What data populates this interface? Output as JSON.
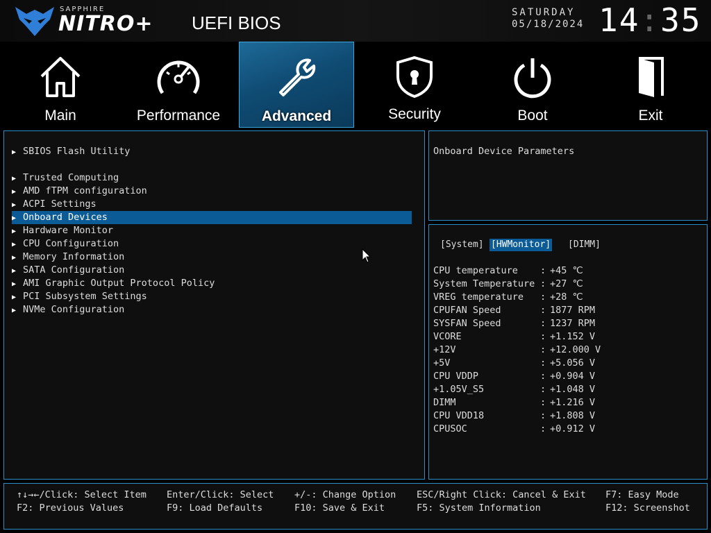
{
  "header": {
    "brand_small": "SAPPHIRE",
    "brand_big": "NITRO+",
    "title": "UEFI BIOS",
    "day": "SATURDAY",
    "date": "05/18/2024",
    "time_hours": "14",
    "time_minutes": "35"
  },
  "tabs": [
    {
      "label": "Main",
      "icon": "home-icon"
    },
    {
      "label": "Performance",
      "icon": "speedometer-icon"
    },
    {
      "label": "Advanced",
      "icon": "wrench-icon",
      "active": true
    },
    {
      "label": "Security",
      "icon": "shield-lock-icon"
    },
    {
      "label": "Boot",
      "icon": "power-icon"
    },
    {
      "label": "Exit",
      "icon": "door-exit-icon"
    }
  ],
  "menu": {
    "items": [
      {
        "label": "SBIOS Flash Utility"
      },
      {
        "label": "Trusted Computing"
      },
      {
        "label": "AMD fTPM configuration"
      },
      {
        "label": "ACPI Settings"
      },
      {
        "label": "Onboard Devices",
        "selected": true
      },
      {
        "label": "Hardware Monitor"
      },
      {
        "label": "CPU Configuration"
      },
      {
        "label": "Memory Information"
      },
      {
        "label": "SATA Configuration"
      },
      {
        "label": "AMI Graphic Output Protocol Policy"
      },
      {
        "label": "PCI Subsystem Settings"
      },
      {
        "label": "NVMe Configuration"
      }
    ]
  },
  "help": {
    "text": "Onboard Device Parameters"
  },
  "hw_monitor": {
    "tabs": [
      "[System]",
      "[HWMonitor]",
      "[DIMM]"
    ],
    "selected_tab": "[HWMonitor]",
    "rows": [
      {
        "name": "CPU temperature",
        "value": "+45 ℃"
      },
      {
        "name": "System Temperature",
        "value": "+27 ℃"
      },
      {
        "name": "VREG temperature",
        "value": "+28 ℃"
      },
      {
        "name": "CPUFAN Speed",
        "value": "1877 RPM"
      },
      {
        "name": "SYSFAN Speed",
        "value": "1237 RPM"
      },
      {
        "name": "VCORE",
        "value": "+1.152 V"
      },
      {
        "name": "+12V",
        "value": "+12.000 V"
      },
      {
        "name": "+5V",
        "value": "+5.056 V"
      },
      {
        "name": "CPU VDDP",
        "value": "+0.904 V"
      },
      {
        "name": "+1.05V_S5",
        "value": "+1.048 V"
      },
      {
        "name": "DIMM",
        "value": "+1.216 V"
      },
      {
        "name": "CPU VDD18",
        "value": "+1.808 V"
      },
      {
        "name": "CPUSOC",
        "value": "+0.912 V"
      }
    ]
  },
  "footer": {
    "keys": [
      "↑↓→←/Click: Select Item",
      "Enter/Click: Select",
      "+/-: Change Option",
      "ESC/Right Click: Cancel & Exit",
      "F7: Easy Mode",
      "F2: Previous Values",
      "F9: Load Defaults",
      "F10: Save & Exit",
      "F5: System Information",
      "F12: Screenshot"
    ]
  },
  "colors": {
    "accent_border": "#2a8ec8",
    "selection": "#0b5c96",
    "active_tab": "#1e6a98",
    "background": "#000000"
  }
}
